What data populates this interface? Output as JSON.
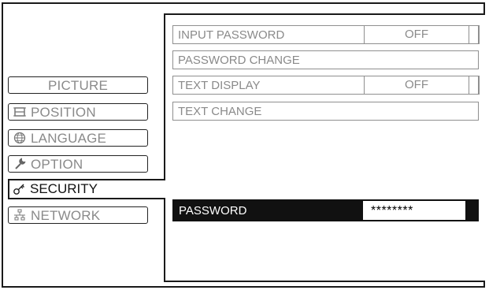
{
  "menu": {
    "items": [
      {
        "label": "PICTURE",
        "icon": "none"
      },
      {
        "label": "POSITION",
        "icon": "position-icon"
      },
      {
        "label": "LANGUAGE",
        "icon": "globe-icon"
      },
      {
        "label": "OPTION",
        "icon": "wrench-icon"
      },
      {
        "label": "SECURITY",
        "icon": "key-icon",
        "selected": true
      },
      {
        "label": "NETWORK",
        "icon": "network-icon"
      }
    ]
  },
  "security": {
    "rows": [
      {
        "label": "INPUT PASSWORD",
        "value": "OFF"
      },
      {
        "label": "PASSWORD CHANGE"
      },
      {
        "label": "TEXT DISPLAY",
        "value": "OFF"
      },
      {
        "label": "TEXT CHANGE"
      }
    ],
    "password": {
      "label": "PASSWORD",
      "value": "********"
    }
  },
  "colors": {
    "frame": "#1a1a1a",
    "inactive_text": "#8a8a8a",
    "highlight_bg": "#111111"
  }
}
